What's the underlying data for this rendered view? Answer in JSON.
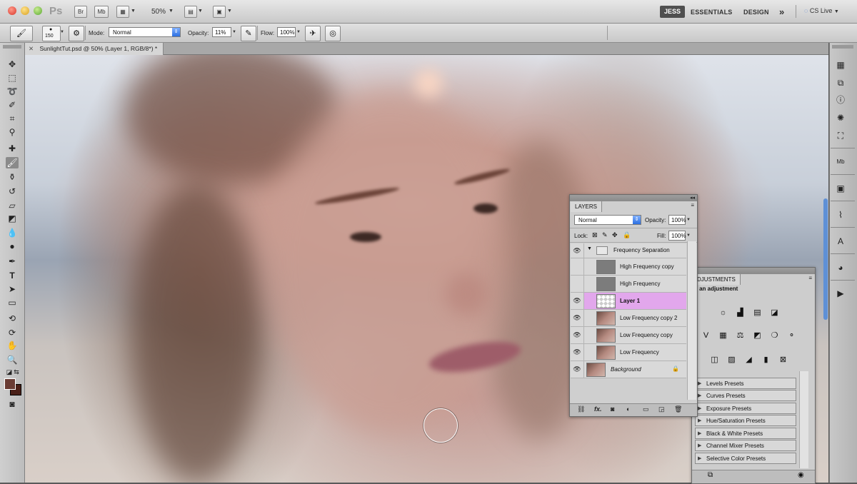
{
  "app": {
    "logo": "Ps",
    "bridge_label": "Br",
    "minibridge_label": "Mb",
    "zoom": "50%",
    "workspaces": {
      "active": "JESS",
      "essentials": "ESSENTIALS",
      "design": "DESIGN",
      "more": "»"
    },
    "cs_live": "CS Live"
  },
  "options": {
    "brush_size": "150",
    "mode_label": "Mode:",
    "mode_value": "Normal",
    "opacity_label": "Opacity:",
    "opacity_value": "11%",
    "flow_label": "Flow:",
    "flow_value": "100%"
  },
  "document": {
    "tab_title": "SunlightTut.psd @ 50% (Layer 1, RGB/8*) *"
  },
  "colors": {
    "foreground": "#6a3c34",
    "background": "#4a2018",
    "selected_layer": "#e2a7ec"
  },
  "layers_panel": {
    "title": "LAYERS",
    "blend_mode": "Normal",
    "opacity_label": "Opacity:",
    "opacity_value": "100%",
    "lock_label": "Lock:",
    "fill_label": "Fill:",
    "fill_value": "100%",
    "layers": [
      {
        "name": "Frequency Separation",
        "visible": true,
        "type": "group"
      },
      {
        "name": "High Frequency copy",
        "visible": false,
        "type": "gray"
      },
      {
        "name": "High Frequency",
        "visible": false,
        "type": "gray"
      },
      {
        "name": "Layer 1",
        "visible": true,
        "type": "transparent",
        "selected": true
      },
      {
        "name": "Low Frequency copy 2",
        "visible": true,
        "type": "photo"
      },
      {
        "name": "Low Frequency copy",
        "visible": true,
        "type": "photo"
      },
      {
        "name": "Low Frequency",
        "visible": true,
        "type": "photo"
      },
      {
        "name": "Background",
        "visible": true,
        "type": "photo",
        "locked": true
      }
    ]
  },
  "adjustments_panel": {
    "title": "DJUSTMENTS",
    "subtitle": "d an adjustment",
    "presets": [
      "Levels Presets",
      "Curves Presets",
      "Exposure Presets",
      "Hue/Saturation Presets",
      "Black & White Presets",
      "Channel Mixer Presets",
      "Selective Color Presets"
    ]
  },
  "icons": {
    "tools": [
      "move-icon",
      "marquee-icon",
      "lasso-icon",
      "quick-select-icon",
      "crop-icon",
      "eyedropper-icon",
      "spot-heal-icon",
      "brush-icon",
      "clone-stamp-icon",
      "history-brush-icon",
      "eraser-icon",
      "gradient-icon",
      "blur-icon",
      "dodge-icon",
      "pen-icon",
      "type-icon",
      "path-select-icon",
      "shape-icon",
      "3d-rotate-icon",
      "3d-orbit-icon",
      "hand-icon",
      "zoom-icon"
    ],
    "dock": [
      "histogram-icon",
      "navigator-icon",
      "info-icon",
      "color-icon",
      "transform-icon",
      "minibridge-icon",
      "swatches-icon",
      "brush-preset-icon",
      "character-icon",
      "paragraph-icon",
      "actions-icon"
    ]
  }
}
